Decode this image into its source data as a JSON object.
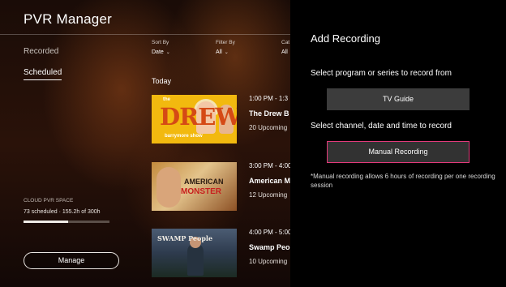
{
  "app": {
    "title": "PVR Manager"
  },
  "nav": {
    "items": [
      {
        "label": "Recorded"
      },
      {
        "label": "Scheduled"
      }
    ]
  },
  "filters": [
    {
      "label": "Sort By",
      "value": "Date"
    },
    {
      "label": "Filter By",
      "value": "All"
    },
    {
      "label": "Cat",
      "value": "All"
    }
  ],
  "list": {
    "section": "Today",
    "programs": [
      {
        "time": "1:00 PM - 1:3",
        "title": "The Drew B",
        "subtitle": "20 Upcoming",
        "thumb": {
          "line1": "the",
          "line2": "DREW",
          "line3": "barrymore show"
        }
      },
      {
        "time": "3:00 PM - 4:00",
        "title": "American M",
        "subtitle": "12 Upcoming",
        "thumb": {
          "line1": "AMERICAN",
          "line2": "MONSTER"
        }
      },
      {
        "time": "4:00 PM - 5:00",
        "title": "Swamp Peo",
        "subtitle": "10 Upcoming",
        "thumb": {
          "line1": "SWAMP People"
        }
      }
    ]
  },
  "storage": {
    "label": "CLOUD PVR SPACE",
    "status": "73 scheduled · 155.2h of 300h",
    "used_fraction": 0.517
  },
  "manage_button": {
    "label": "Manage"
  },
  "panel": {
    "title": "Add Recording",
    "instruction_1": "Select program or series to record from",
    "tv_guide_button": "TV Guide",
    "instruction_2": "Select channel, date and time to record",
    "manual_button": "Manual Recording",
    "note": "*Manual recording allows 6 hours of recording per one recording session"
  },
  "colors": {
    "accent": "#e23a7a",
    "panel_bg": "#000000",
    "button_bg": "#3c3c3c"
  }
}
